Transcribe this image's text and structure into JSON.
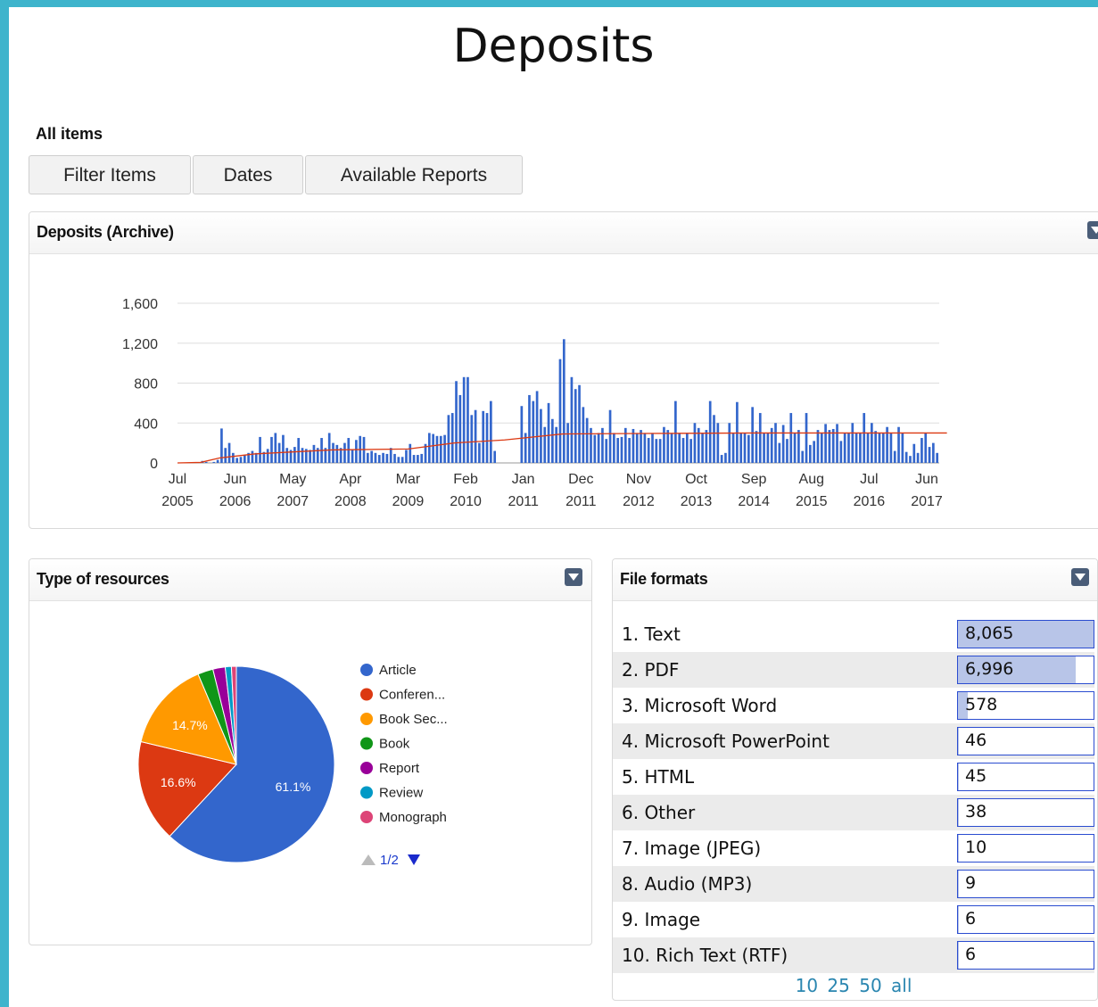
{
  "page_title": "Deposits",
  "subtitle": "All items",
  "toolbar": {
    "filter_label": "Filter Items",
    "dates_label": "Dates",
    "reports_label": "Available Reports"
  },
  "archive_panel": {
    "title": "Deposits (Archive)"
  },
  "resources_panel": {
    "title": "Type of resources",
    "pager_text": "1/2"
  },
  "formats_panel": {
    "title": "File formats",
    "pager": [
      "10",
      "25",
      "50",
      "all"
    ],
    "rows": [
      {
        "num": "1.",
        "label": "Text",
        "value": "8,065",
        "fill": 1.0
      },
      {
        "num": "2.",
        "label": "PDF",
        "value": "6,996",
        "fill": 0.867
      },
      {
        "num": "3.",
        "label": "Microsoft Word",
        "value": "578",
        "fill": 0.072
      },
      {
        "num": "4.",
        "label": "Microsoft PowerPoint",
        "value": "46",
        "fill": 0.006
      },
      {
        "num": "5.",
        "label": "HTML",
        "value": "45",
        "fill": 0.006
      },
      {
        "num": "6.",
        "label": "Other",
        "value": "38",
        "fill": 0.005
      },
      {
        "num": "7.",
        "label": "Image (JPEG)",
        "value": "10",
        "fill": 0.001
      },
      {
        "num": "8.",
        "label": "Audio (MP3)",
        "value": "9",
        "fill": 0.001
      },
      {
        "num": "9.",
        "label": "Image",
        "value": "6",
        "fill": 0.001
      },
      {
        "num": "10.",
        "label": "Rich Text (RTF)",
        "value": "6",
        "fill": 0.001
      }
    ]
  },
  "colors": {
    "bar": "#3366cc",
    "trend": "#dc3912",
    "pie": [
      "#3366cc",
      "#dc3912",
      "#ff9900",
      "#109618",
      "#990099",
      "#0099c6",
      "#dd4477"
    ]
  },
  "chart_data": [
    {
      "type": "bar",
      "title": "Deposits (Archive)",
      "ylim": [
        0,
        1600
      ],
      "yticks": [
        "0",
        "400",
        "800",
        "1,200",
        "1,600"
      ],
      "xticks": [
        [
          "Jul",
          "2005"
        ],
        [
          "Jun",
          "2006"
        ],
        [
          "May",
          "2007"
        ],
        [
          "Apr",
          "2008"
        ],
        [
          "Mar",
          "2009"
        ],
        [
          "Feb",
          "2010"
        ],
        [
          "Jan",
          "2011"
        ],
        [
          "Dec",
          "2011"
        ],
        [
          "Nov",
          "2012"
        ],
        [
          "Oct",
          "2013"
        ],
        [
          "Sep",
          "2014"
        ],
        [
          "Aug",
          "2015"
        ],
        [
          "Jul",
          "2016"
        ],
        [
          "Jun",
          "2017"
        ]
      ],
      "x_start": "2005-07",
      "values": [
        0,
        0,
        0,
        0,
        0,
        0,
        20,
        10,
        0,
        10,
        30,
        345,
        150,
        200,
        100,
        50,
        60,
        80,
        100,
        120,
        100,
        260,
        110,
        140,
        260,
        300,
        200,
        280,
        150,
        130,
        160,
        250,
        150,
        140,
        130,
        180,
        150,
        250,
        150,
        300,
        200,
        180,
        150,
        200,
        250,
        130,
        230,
        270,
        260,
        100,
        120,
        100,
        80,
        100,
        90,
        150,
        90,
        60,
        60,
        130,
        190,
        80,
        80,
        90,
        190,
        300,
        290,
        270,
        270,
        280,
        480,
        500,
        820,
        680,
        860,
        860,
        480,
        530,
        200,
        520,
        500,
        620,
        120,
        0,
        0,
        0,
        0,
        0,
        0,
        570,
        300,
        680,
        620,
        720,
        540,
        360,
        600,
        440,
        360,
        1040,
        1240,
        400,
        860,
        740,
        780,
        560,
        450,
        350,
        280,
        300,
        350,
        240,
        530,
        300,
        250,
        260,
        350,
        250,
        340,
        300,
        330,
        300,
        250,
        300,
        240,
        240,
        360,
        330,
        300,
        620,
        300,
        250,
        300,
        240,
        400,
        350,
        300,
        330,
        620,
        480,
        400,
        80,
        100,
        400,
        300,
        610,
        300,
        300,
        280,
        560,
        320,
        500,
        300,
        300,
        350,
        400,
        200,
        380,
        240,
        500,
        300,
        330,
        120,
        500,
        180,
        220,
        330,
        300,
        390,
        330,
        340,
        390,
        220,
        300,
        300,
        400,
        300,
        300,
        500,
        300,
        400,
        320,
        300,
        300,
        360,
        300,
        120,
        360,
        300,
        110,
        70,
        190,
        100,
        250,
        300,
        160,
        200,
        100
      ],
      "trend": [
        [
          0,
          0
        ],
        [
          6,
          5
        ],
        [
          11,
          50
        ],
        [
          20,
          90
        ],
        [
          40,
          130
        ],
        [
          60,
          140
        ],
        [
          72,
          200
        ],
        [
          85,
          230
        ],
        [
          100,
          290
        ],
        [
          120,
          295
        ],
        [
          150,
          300
        ],
        [
          180,
          300
        ],
        [
          200,
          300
        ]
      ],
      "series": [
        {
          "name": "Deposits"
        }
      ]
    },
    {
      "type": "pie",
      "title": "Type of resources",
      "categories": [
        "Article",
        "Conferen...",
        "Book Sec...",
        "Book",
        "Report",
        "Review",
        "Monograph"
      ],
      "values": [
        61.1,
        16.6,
        14.7,
        2.5,
        2.0,
        1.0,
        0.8
      ],
      "labels": [
        "61.1%",
        "16.6%",
        "14.7%"
      ],
      "legend": "right"
    }
  ]
}
